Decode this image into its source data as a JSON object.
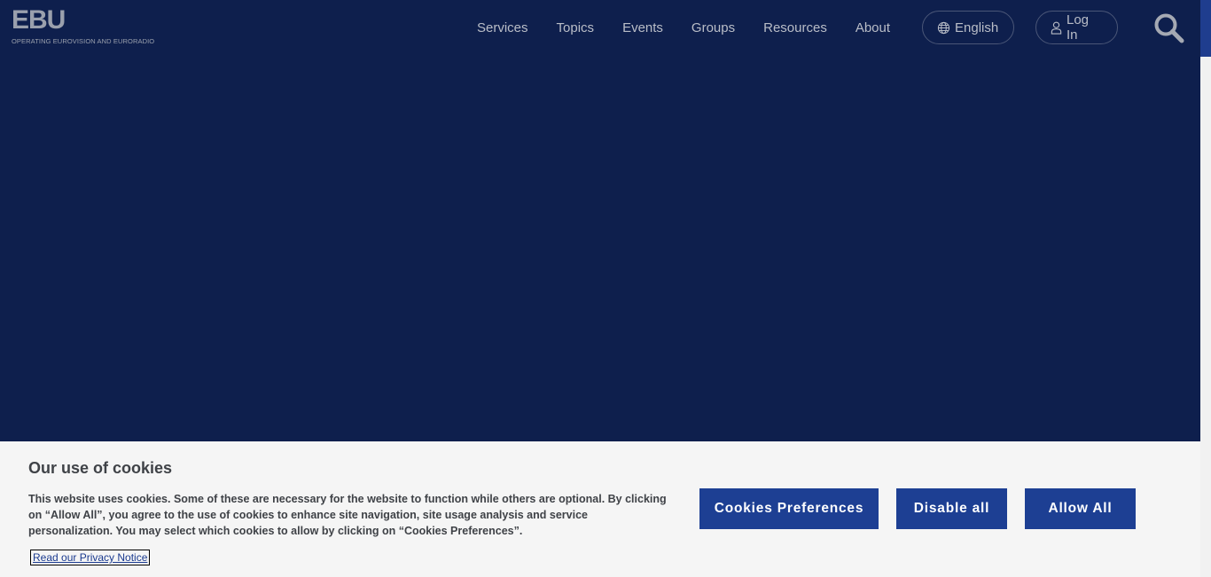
{
  "logo": {
    "mark": "EBU",
    "tagline": "OPERATING EUROVISION AND EURORADIO"
  },
  "nav": {
    "items": [
      {
        "label": "Services"
      },
      {
        "label": "Topics"
      },
      {
        "label": "Events"
      },
      {
        "label": "Groups"
      },
      {
        "label": "Resources"
      },
      {
        "label": "About"
      }
    ],
    "language_label": "English",
    "language_icon": "globe-icon",
    "login_label": "Log In",
    "login_icon": "user-icon",
    "search_icon": "search-icon"
  },
  "cookie_banner": {
    "title": "Our use of cookies",
    "text": "This website uses cookies. Some of these are necessary for the website to function while others are optional. By clicking on “Allow All”, you agree to the use of cookies to enhance site navigation, site usage analysis and service personalization. You may select which cookies to allow by clicking on “Cookies Preferences”.",
    "privacy_link": "Read our Privacy Notice",
    "buttons": {
      "preferences": "Cookies Preferences",
      "disable": "Disable all",
      "allow": "Allow All"
    }
  },
  "colors": {
    "background": "#0e1f4d",
    "banner_background": "#f5f5f5",
    "button": "#1d3f93",
    "nav_text": "#b9bdc7"
  }
}
